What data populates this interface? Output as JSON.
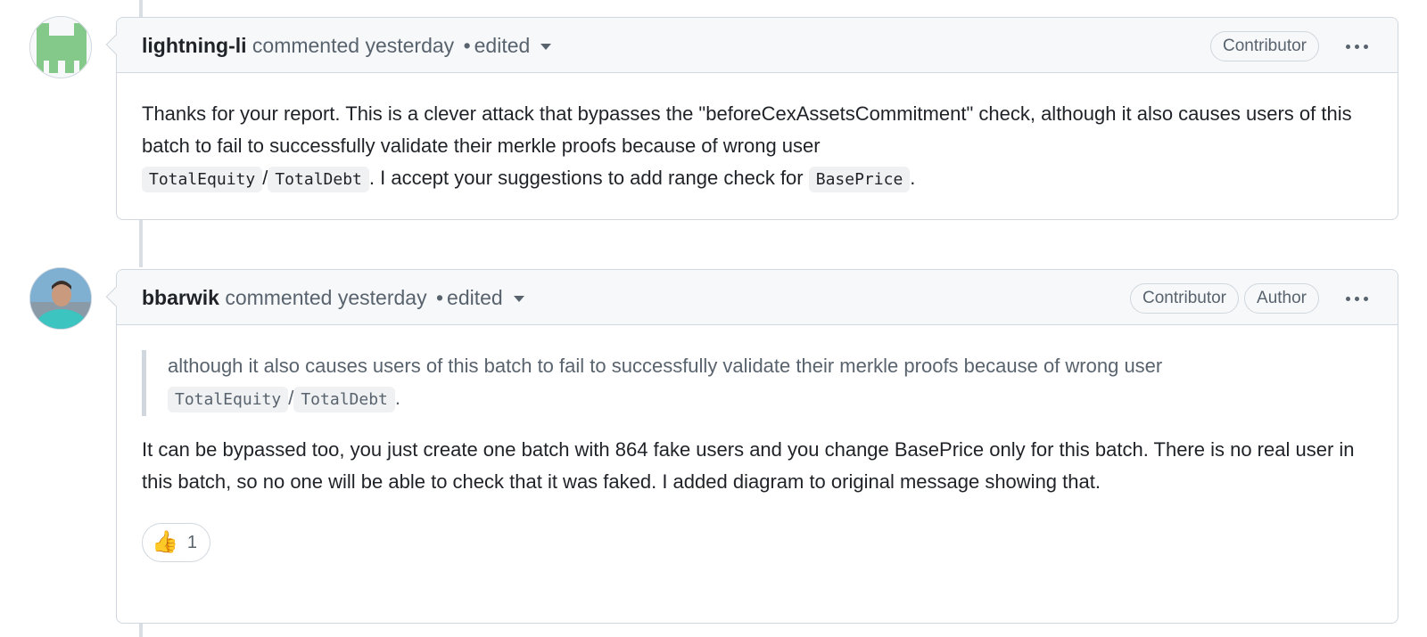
{
  "comments": [
    {
      "author": "lightning-li",
      "meta": "commented yesterday",
      "edited": "edited",
      "badges": [
        "Contributor"
      ],
      "avatar_icon": "identicon-avatar",
      "body": {
        "p1_a": "Thanks for your report. This is a clever attack that bypasses the \"beforeCexAssetsCommitment\" check, although it also causes users of this batch to fail to successfully validate their merkle proofs because of wrong user",
        "code1": "TotalEquity",
        "sep": "/",
        "code2": "TotalDebt",
        "p1_b": ". I accept your suggestions to add range check for",
        "code3": "BasePrice",
        "p1_c": "."
      }
    },
    {
      "author": "bbarwik",
      "meta": "commented yesterday",
      "edited": "edited",
      "badges": [
        "Contributor",
        "Author"
      ],
      "avatar_icon": "user-photo-avatar",
      "quote": {
        "text": "although it also causes users of this batch to fail to successfully validate their merkle proofs because of wrong user",
        "code1": "TotalEquity",
        "sep": "/",
        "code2": "TotalDebt",
        "end": "."
      },
      "body": "It can be bypassed too, you just create one batch with 864 fake users and you change BasePrice only for this batch. There is no real user in this batch, so no one will be able to check that it was faked. I added diagram to original message showing that.",
      "reaction": {
        "emoji": "👍",
        "count": "1"
      }
    }
  ],
  "colors": {
    "border": "#d0d7de",
    "header_bg": "#f6f8fa",
    "muted_text": "#59636e",
    "text": "#1f2328"
  }
}
